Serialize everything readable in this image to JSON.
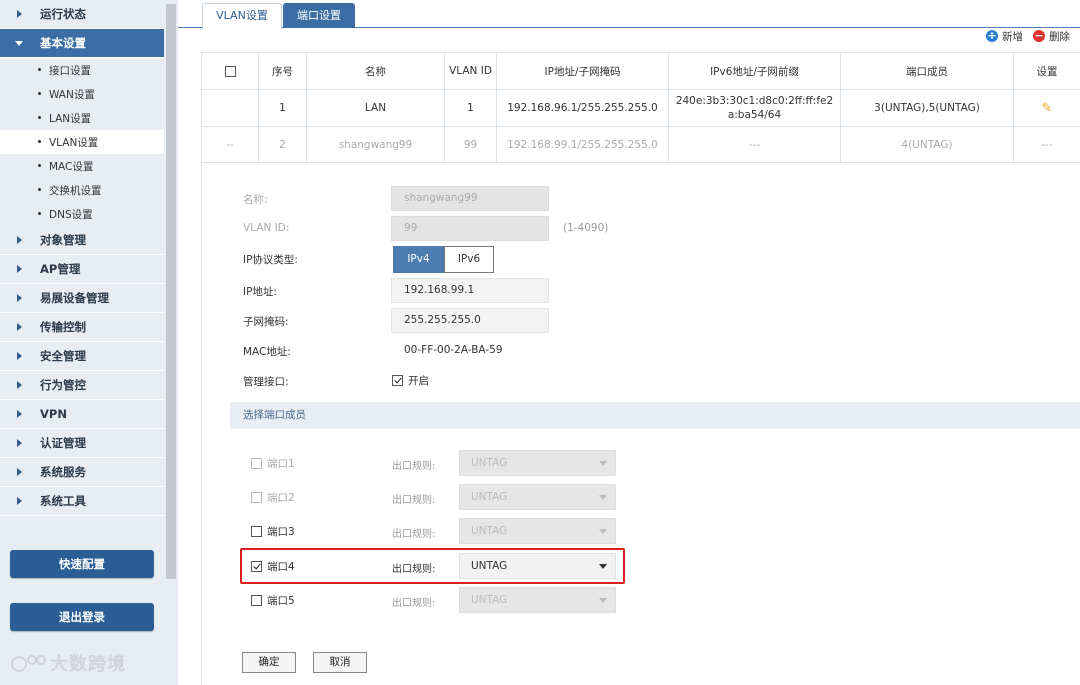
{
  "sidebar": {
    "items": [
      {
        "label": "运行状态"
      },
      {
        "label": "基本设置"
      },
      {
        "label": "对象管理"
      },
      {
        "label": "AP管理"
      },
      {
        "label": "易展设备管理"
      },
      {
        "label": "传输控制"
      },
      {
        "label": "安全管理"
      },
      {
        "label": "行为管控"
      },
      {
        "label": "VPN"
      },
      {
        "label": "认证管理"
      },
      {
        "label": "系统服务"
      },
      {
        "label": "系统工具"
      }
    ],
    "sub_items": [
      {
        "label": "接口设置"
      },
      {
        "label": "WAN设置"
      },
      {
        "label": "LAN设置"
      },
      {
        "label": "VLAN设置"
      },
      {
        "label": "MAC设置"
      },
      {
        "label": "交换机设置"
      },
      {
        "label": "DNS设置"
      }
    ],
    "quick_config": "快速配置",
    "logout": "退出登录"
  },
  "watermark": "大数跨境",
  "tabs": [
    {
      "label": "VLAN设置"
    },
    {
      "label": "端口设置"
    }
  ],
  "actions": {
    "add": "新增",
    "delete": "删除"
  },
  "table": {
    "headers": [
      "序号",
      "名称",
      "VLAN ID",
      "IP地址/子网掩码",
      "IPv6地址/子网前缀",
      "端口成员",
      "设置"
    ],
    "rows": [
      {
        "check": "",
        "no": "1",
        "name": "LAN",
        "vlan_id": "1",
        "ip": "192.168.96.1/255.255.255.0",
        "ipv6": "240e:3b3:30c1:d8c0:2ff:ff:fe2a:ba54/64",
        "members": "3(UNTAG),5(UNTAG)"
      },
      {
        "check": "--",
        "no": "2",
        "name": "shangwang99",
        "vlan_id": "99",
        "ip": "192.168.99.1/255.255.255.0",
        "ipv6": "---",
        "members": "4(UNTAG)",
        "settings": "---"
      }
    ]
  },
  "form": {
    "name_label": "名称:",
    "name_value": "shangwang99",
    "vlan_label": "VLAN ID:",
    "vlan_value": "99",
    "vlan_hint": "(1-4090)",
    "proto_label": "IP协议类型:",
    "proto_v4": "IPv4",
    "proto_v6": "IPv6",
    "ip_label": "IP地址:",
    "ip_value": "192.168.99.1",
    "mask_label": "子网掩码:",
    "mask_value": "255.255.255.0",
    "mac_label": "MAC地址:",
    "mac_value": "00-FF-00-2A-BA-59",
    "mgmt_label": "管理接口:",
    "mgmt_value": "开启"
  },
  "ports_section": "选择端口成员",
  "ports": [
    {
      "label": "端口1",
      "rule_label": "出口规则:",
      "rule": "UNTAG"
    },
    {
      "label": "端口2",
      "rule_label": "出口规则:",
      "rule": "UNTAG"
    },
    {
      "label": "端口3",
      "rule_label": "出口规则:",
      "rule": "UNTAG"
    },
    {
      "label": "端口4",
      "rule_label": "出口规则:",
      "rule": "UNTAG"
    },
    {
      "label": "端口5",
      "rule_label": "出口规则:",
      "rule": "UNTAG"
    }
  ],
  "buttons": {
    "ok": "确定",
    "cancel": "取消"
  },
  "colors": {
    "accent": "#3a6ea5",
    "highlight": "#e02020",
    "add": "#2a7fd4",
    "delete": "#e0312e"
  }
}
